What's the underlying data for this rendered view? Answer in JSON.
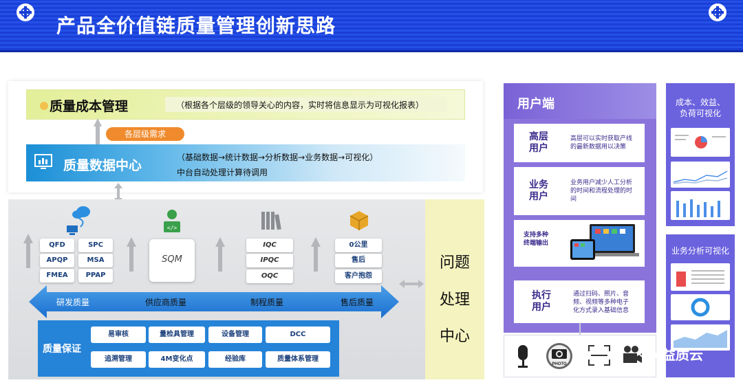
{
  "header": {
    "title": "产品全价值链质量管理创新思路"
  },
  "cost_mgmt": {
    "title": "质量成本管理",
    "description": "（根据各个层级的领导关心的内容，实时将信息显示为可视化报表）",
    "request_badge": "各层级需求"
  },
  "data_center": {
    "title": "质量数据中心",
    "line1": "（基础数据→统计数据→分析数据→业务数据→可视化）",
    "line2": "中台自动处理计算待调用"
  },
  "rd_modules": [
    "QFD",
    "SPC",
    "APQP",
    "MSA",
    "FMEA",
    "PPAP"
  ],
  "sqm_label": "SQM",
  "process_modules": [
    "IQC",
    "IPQC",
    "OQC"
  ],
  "after_sales_modules": [
    "0公里",
    "售后",
    "客户抱怨"
  ],
  "stages": [
    "研发质量",
    "供应商质量",
    "制程质量",
    "售后质量"
  ],
  "problem_center": [
    "问题",
    "处理",
    "中心"
  ],
  "quality_assurance": {
    "title": "质量保证",
    "items": [
      "易审核",
      "量检具管理",
      "设备管理",
      "DCC",
      "追溯管理",
      "4M变化点",
      "经验库",
      "质量体系管理"
    ]
  },
  "user_end": {
    "title": "用户端",
    "cards": [
      {
        "name_line1": "高层",
        "name_line2": "用户",
        "desc_lines": [
          "高层可以实时获取产线",
          "的最新数据用以决策"
        ]
      },
      {
        "name_line1": "业务",
        "name_line2": "用户",
        "desc_lines": [
          "业务用户减少人工分析",
          "的时间和流程处理的时",
          "间"
        ]
      },
      {
        "name_line1": "支持多种",
        "name_line2": "终端输出",
        "desc_lines": []
      },
      {
        "name_line1": "执行",
        "name_line2": "用户",
        "desc_lines": [
          "通过扫码、照片、音",
          "频、视频等多种电子",
          "化方式录入基础信息"
        ]
      }
    ],
    "icons": [
      "microphone-icon",
      "camera-icon",
      "scan-icon",
      "video-icon"
    ],
    "photo_label": "PHOTO"
  },
  "visualization": {
    "top_title_line1": "成本、效益、",
    "top_title_line2": "负荷可视化",
    "bottom_title": "业务分析可视化"
  },
  "watermark": "益质云",
  "colors": {
    "banner": "#1a3fd6",
    "cost_bar": "#e4ef9a",
    "data_center": "#1b8fd6",
    "badge": "#f08b2d",
    "qa_box": "#2583d8",
    "user_panel": "#8a74dc",
    "viz_panel": "#6b62de",
    "problem_center": "#f5f3bf"
  }
}
